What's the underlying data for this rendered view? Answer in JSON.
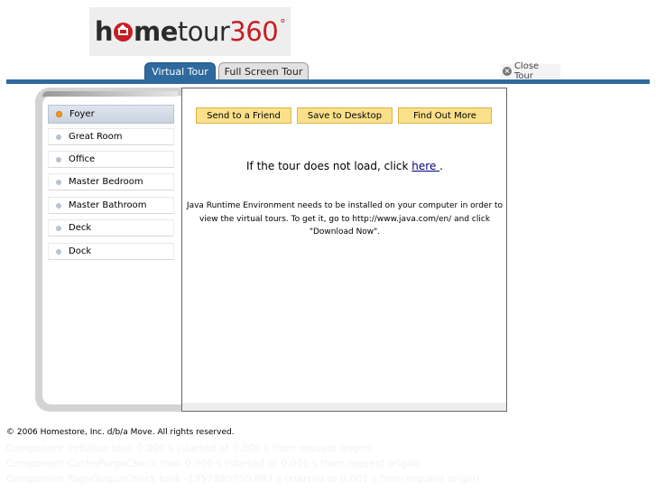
{
  "logo": {
    "part_h": "h",
    "part_me": "me",
    "part_tour": "tour",
    "part_360": "360",
    "part_deg": "°"
  },
  "tabs": [
    {
      "label": "Virtual Tour",
      "active": true
    },
    {
      "label": "Full Screen Tour",
      "active": false
    }
  ],
  "close_tour": {
    "label": "Close Tour",
    "icon": "close-circle-icon"
  },
  "sidebar": {
    "items": [
      {
        "label": "Foyer",
        "active": true
      },
      {
        "label": "Great Room",
        "active": false
      },
      {
        "label": "Office",
        "active": false
      },
      {
        "label": "Master Bedroom",
        "active": false
      },
      {
        "label": "Master Bathroom",
        "active": false
      },
      {
        "label": "Deck",
        "active": false
      },
      {
        "label": "Dock",
        "active": false
      }
    ]
  },
  "actions": {
    "send": "Send to a Friend",
    "save": "Save to Desktop",
    "find": "Find Out More"
  },
  "tour_message": {
    "prefix": "If the tour does not load, click ",
    "link": "here ",
    "suffix": "."
  },
  "java_message": "Java Runtime Environment needs to be installed on your computer in order to view the virtual tours. To get it, go to http://www.java.com/en/ and click \"Download Now\".",
  "footer": "© 2006 Homestore, Inc. d/b/a Move. All rights reserved.",
  "debug_lines": [
    "Component Initialize took 0.000 s (started at 0.000 s from request origin)",
    "Component CachePurgeCheck took 0.000 s (started at 0.001 s from request origin)",
    "Component PageOutputCheck took -1357880750.893 s (started at 0.001 s from request origin)"
  ],
  "colors": {
    "brand_blue": "#2f6a9e",
    "brand_red": "#c71d23",
    "button_yellow": "#fbe08b",
    "active_bullet": "#f29a1d"
  }
}
